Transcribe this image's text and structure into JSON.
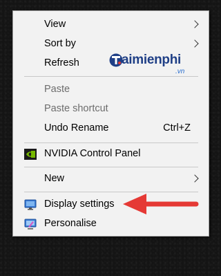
{
  "menu": {
    "items": [
      {
        "label": "View",
        "submenu": true
      },
      {
        "label": "Sort by",
        "submenu": true
      },
      {
        "label": "Refresh"
      },
      {
        "label": "Paste",
        "disabled": true
      },
      {
        "label": "Paste shortcut",
        "disabled": true
      },
      {
        "label": "Undo Rename",
        "shortcut": "Ctrl+Z"
      },
      {
        "label": "NVIDIA Control Panel",
        "icon": "nvidia-icon"
      },
      {
        "label": "New",
        "submenu": true
      },
      {
        "label": "Display settings",
        "icon": "display-icon"
      },
      {
        "label": "Personalise",
        "icon": "personalise-icon"
      }
    ]
  },
  "watermark": {
    "text": "aimienphi",
    "suffix": ".vn",
    "logo_icon": "taimienphi-logo-icon"
  },
  "annotation": {
    "arrow_color": "#e53935",
    "icon": "red-arrow-icon"
  },
  "colors": {
    "menu_bg": "#f2f2f2",
    "disabled_text": "#6d6d6d",
    "nvidia_green": "#76b900",
    "arrow_red": "#e53935"
  }
}
